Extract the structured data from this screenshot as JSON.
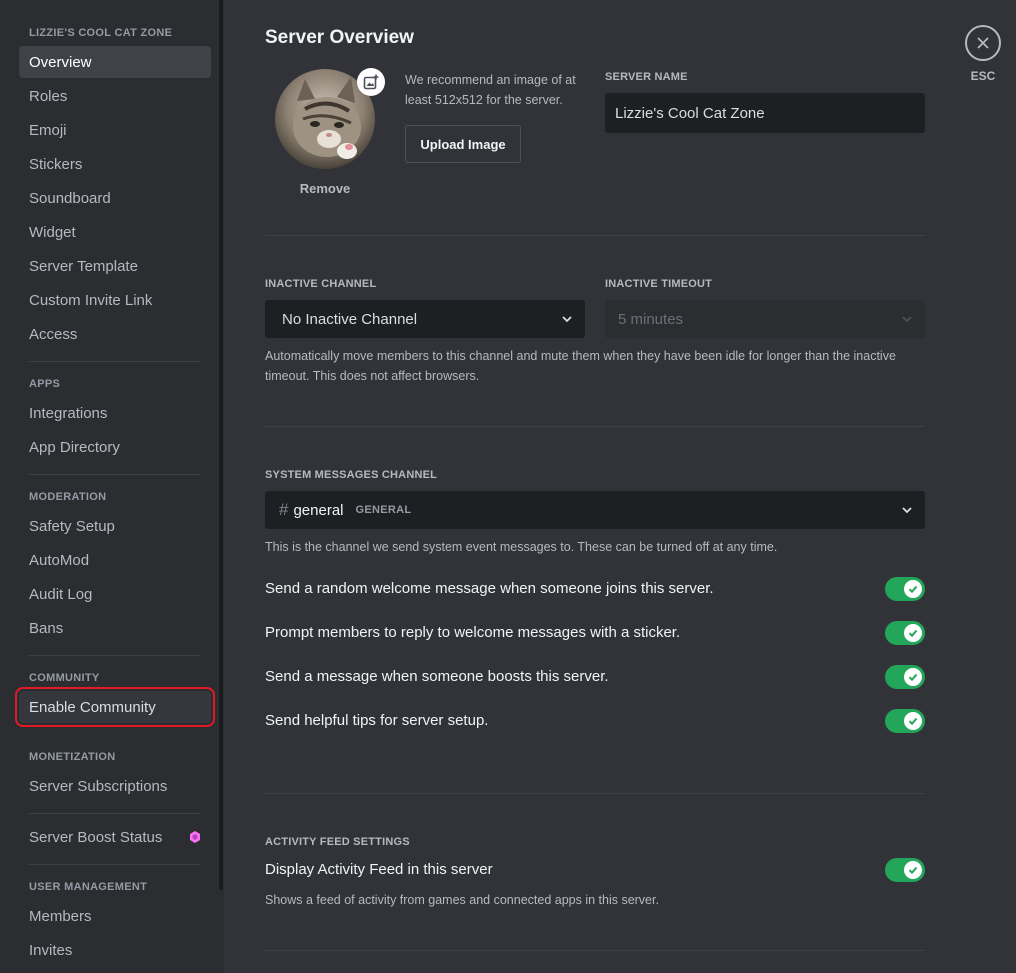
{
  "sidebar": {
    "server_header": "LIZZIE'S COOL CAT ZONE",
    "server_items": [
      {
        "label": "Overview"
      },
      {
        "label": "Roles"
      },
      {
        "label": "Emoji"
      },
      {
        "label": "Stickers"
      },
      {
        "label": "Soundboard"
      },
      {
        "label": "Widget"
      },
      {
        "label": "Server Template"
      },
      {
        "label": "Custom Invite Link"
      },
      {
        "label": "Access"
      }
    ],
    "apps_header": "APPS",
    "apps_items": [
      {
        "label": "Integrations"
      },
      {
        "label": "App Directory"
      }
    ],
    "moderation_header": "MODERATION",
    "moderation_items": [
      {
        "label": "Safety Setup"
      },
      {
        "label": "AutoMod"
      },
      {
        "label": "Audit Log"
      },
      {
        "label": "Bans"
      }
    ],
    "community_header": "COMMUNITY",
    "community_items": [
      {
        "label": "Enable Community"
      }
    ],
    "monetization_header": "MONETIZATION",
    "monetization_items": [
      {
        "label": "Server Subscriptions"
      }
    ],
    "boost_item": {
      "label": "Server Boost Status",
      "icon": "boost-gem-icon"
    },
    "user_mgmt_header": "USER MANAGEMENT",
    "user_mgmt_items": [
      {
        "label": "Members"
      },
      {
        "label": "Invites"
      }
    ],
    "selected": "Overview",
    "highlighted": "Enable Community"
  },
  "main": {
    "title": "Server Overview",
    "avatar": {
      "remove_label": "Remove",
      "edit_icon": "add-image-icon"
    },
    "recommend_text": "We recommend an image of at least 512x512 for the server.",
    "upload_label": "Upload Image",
    "server_name": {
      "label": "SERVER NAME",
      "value": "Lizzie's Cool Cat Zone"
    },
    "inactive_channel": {
      "label": "INACTIVE CHANNEL",
      "value": "No Inactive Channel"
    },
    "inactive_timeout": {
      "label": "INACTIVE TIMEOUT",
      "value": "5 minutes"
    },
    "inactive_desc": "Automatically move members to this channel and mute them when they have been idle for longer than the inactive timeout. This does not affect browsers.",
    "system_channel": {
      "label": "SYSTEM MESSAGES CHANNEL",
      "hash": "#",
      "channel": "general",
      "category": "GENERAL"
    },
    "system_desc": "This is the channel we send system event messages to. These can be turned off at any time.",
    "toggles": [
      {
        "label": "Send a random welcome message when someone joins this server.",
        "on": true
      },
      {
        "label": "Prompt members to reply to welcome messages with a sticker.",
        "on": true
      },
      {
        "label": "Send a message when someone boosts this server.",
        "on": true
      },
      {
        "label": "Send helpful tips for server setup.",
        "on": true
      }
    ],
    "activity": {
      "header": "ACTIVITY FEED SETTINGS",
      "label": "Display Activity Feed in this server",
      "on": true,
      "desc": "Shows a feed of activity from games and connected apps in this server."
    }
  },
  "close": {
    "icon": "close-icon",
    "esc_label": "ESC"
  },
  "colors": {
    "sidebar_bg": "#2b2d31",
    "main_bg": "#313338",
    "input_bg": "#1e1f22",
    "toggle_on": "#23a55a",
    "highlight_border": "#e01b24",
    "boost_pink": "#ff73fa"
  }
}
